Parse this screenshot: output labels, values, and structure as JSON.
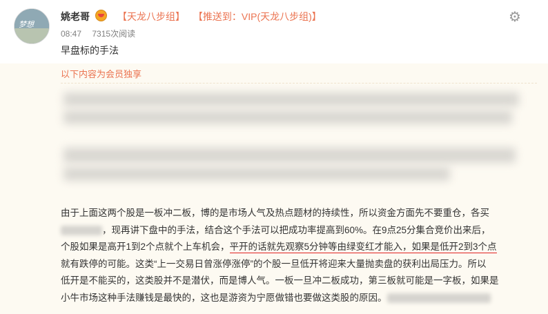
{
  "post": {
    "author": "姚老哥",
    "tags": [
      "【天龙八步组】",
      "【推送到：VIP(天龙八步组)】"
    ],
    "time": "08:47",
    "views": "7315次阅读",
    "summary": "早盘标的手法",
    "avatar_text": "梦想"
  },
  "content": {
    "member_notice": "以下内容为会员独享",
    "paragraph": [
      "由于上面这两个股是一板冲二板，博的是市场人气及热点题材的持续性，所以资金方面先不要重仓，各买",
      "，现再讲下盘中的手法，结合这个手法可以把成功率提高到60%。在9点25分集合竞价出来后，",
      "个股如果是高开1到2个点就个上车机会，",
      "平开的话就先观察5分钟等由绿变红才能入，如果是低开2到3个点",
      "就有跌停的可能。这类“上一交易日曾涨停涨停”的个股一旦低开将迎来大量抛卖盘的获利出局压力。所以",
      "低开是不能买的，这类股并不是潜伏，而是博人气。一板一旦冲二板成功，第三板就可能是一字板，如果是",
      "小牛市场这种手法赚钱是最快的，这也是游资为宁愿做错也要做这类股的原因。"
    ]
  },
  "colors": {
    "accent": "#eb7350",
    "underline": "#e02020",
    "content_bg": "#fdfaf2"
  },
  "icons": {
    "settings": "gear-icon",
    "vip": "vip-badge-icon"
  }
}
